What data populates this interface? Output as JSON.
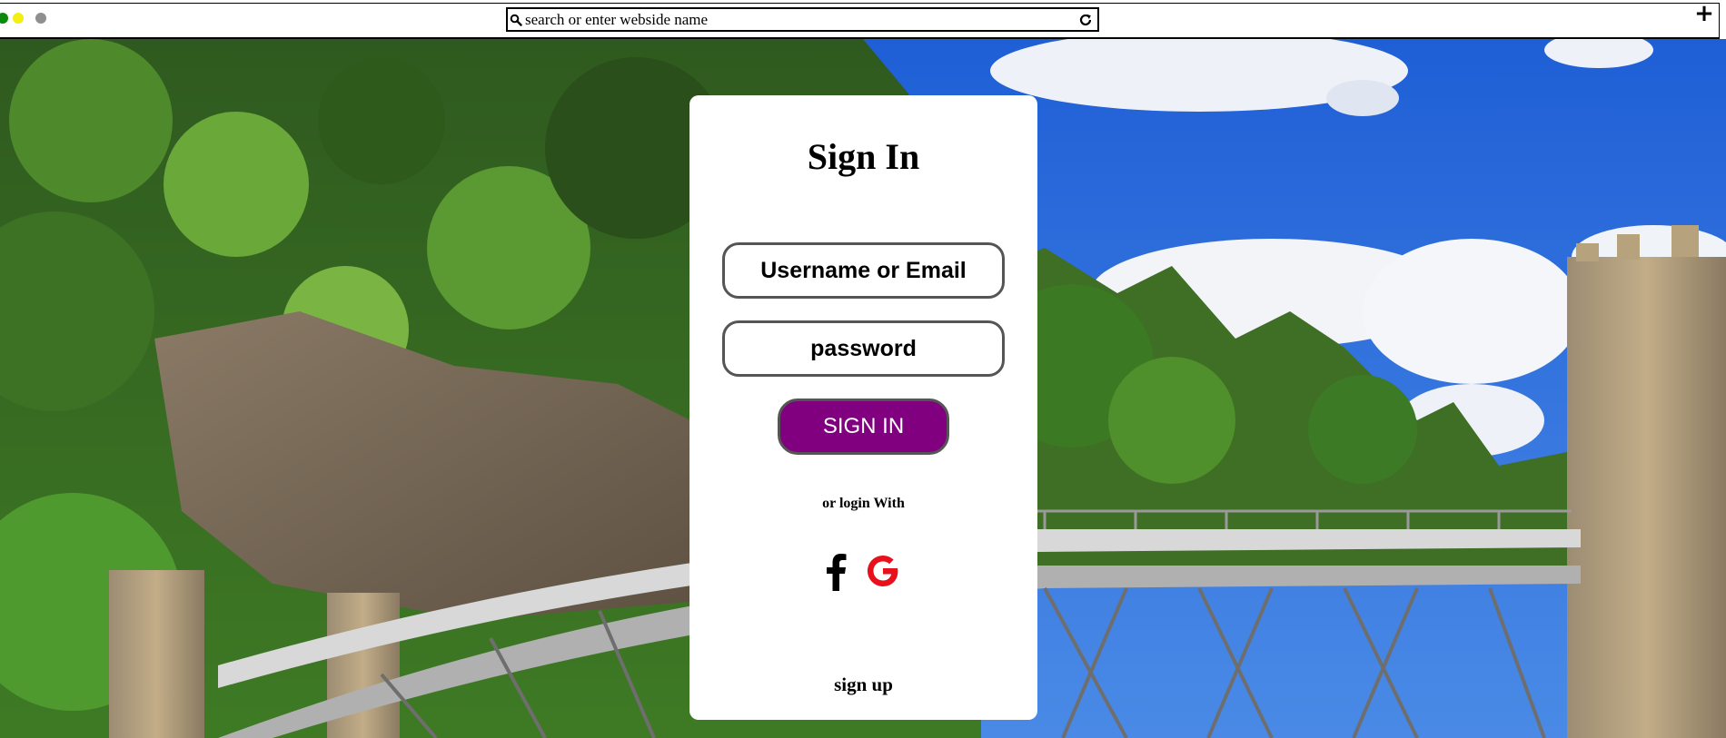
{
  "browser": {
    "address_placeholder": "search or enter webside name",
    "new_tab_symbol": "+",
    "window_dots": [
      "green",
      "yellow",
      "grey"
    ]
  },
  "signin_card": {
    "title": "Sign In",
    "username_placeholder": "Username or Email",
    "password_placeholder": "password",
    "submit_label": "SIGN IN",
    "alt_login_text": "or login With",
    "signup_label": "sign up",
    "social_icons": [
      "facebook-icon",
      "google-icon"
    ]
  },
  "colors": {
    "submit_button": "#800080",
    "google_icon": "#e8101a",
    "facebook_icon": "#000000",
    "dot_green": "#0a8a0a",
    "dot_yellow": "#f3ef12",
    "dot_grey": "#8f8f8f"
  }
}
